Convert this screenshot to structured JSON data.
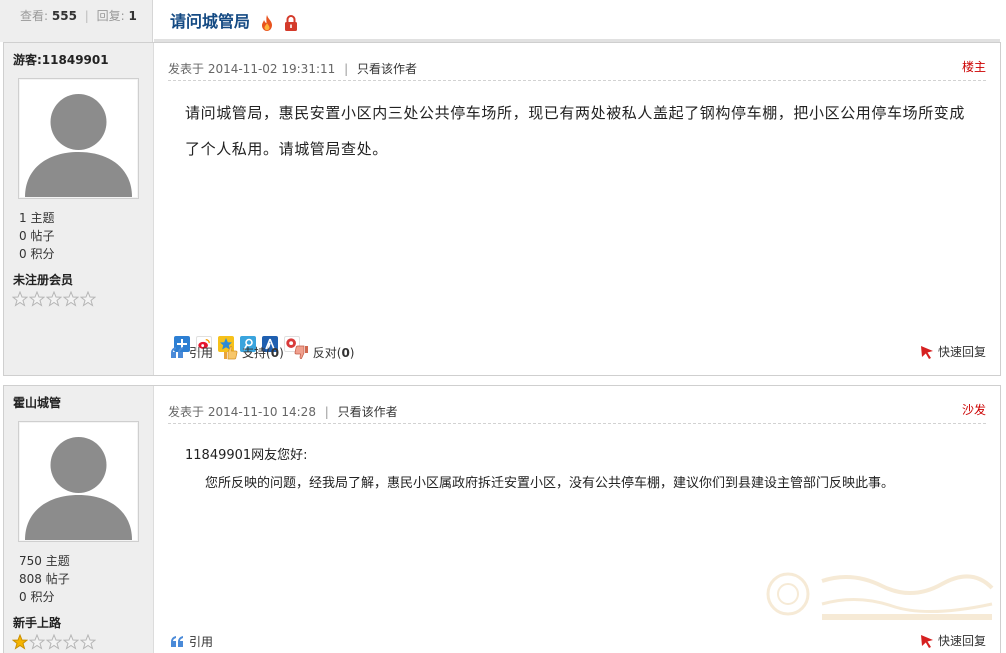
{
  "thread": {
    "views_label": "查看:",
    "views": "555",
    "replies_label": "回复:",
    "replies": "1",
    "title": "请问城管局"
  },
  "posts": [
    {
      "author": "游客:11849901",
      "stats": [
        "1 主题",
        "0 帖子",
        "0 积分"
      ],
      "rank": "未注册会员",
      "stars_filled": 0,
      "posted_at": "发表于 2014-11-02 19:31:11",
      "only_author": "只看该作者",
      "floor": "楼主",
      "content": "请问城管局，惠民安置小区内三处公共停车场所，现已有两处被私人盖起了钢构停车棚，把小区公用停车场所变成了个人私用。请城管局查处。",
      "quote_label": "引用",
      "support_label": "支持(",
      "support_count": "0",
      "oppose_label": "反对(",
      "oppose_count": "0",
      "close_paren": ")",
      "quick_reply": "快速回复",
      "share_icons": [
        "share-plus-icon",
        "weibo-icon",
        "qzone-icon",
        "tencent-weibo-icon",
        "renren-icon",
        "kaixin-icon"
      ]
    },
    {
      "author": "霍山城管",
      "stats": [
        "750 主题",
        "808 帖子",
        "0 积分"
      ],
      "rank": "新手上路",
      "stars_filled": 1,
      "posted_at": "发表于 2014-11-10 14:28",
      "only_author": "只看该作者",
      "floor": "沙发",
      "greeting": "11849901网友您好:",
      "content": "您所反映的问题，经我局了解，惠民小区属政府拆迁安置小区，没有公共停车棚，建议你们到县建设主管部门反映此事。",
      "quote_label": "引用",
      "quick_reply": "快速回复"
    }
  ],
  "colors": {
    "title": "#144a83",
    "floor": "#cc0000",
    "sidebar_bg": "#eeeeee"
  }
}
